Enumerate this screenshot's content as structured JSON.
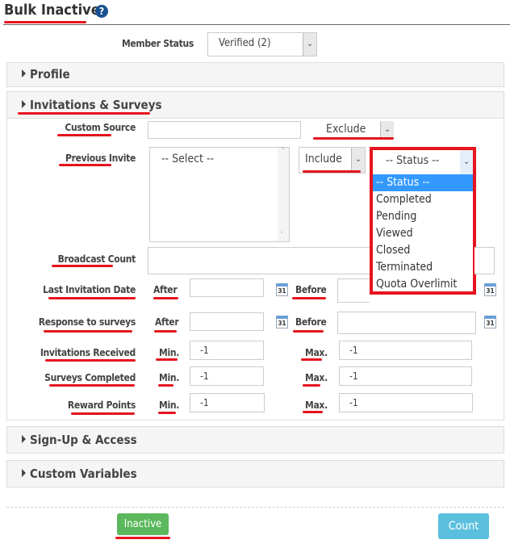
{
  "header": {
    "title": "Bulk Inactive",
    "help_icon": "question-circle-icon"
  },
  "member_status": {
    "label": "Member Status",
    "value": "Verified (2)"
  },
  "panels": {
    "profile": "Profile",
    "invitations": "Invitations & Surveys",
    "signup": "Sign-Up & Access",
    "custom_vars": "Custom Variables"
  },
  "form": {
    "custom_source": {
      "label": "Custom Source",
      "value": "",
      "mode": "Exclude"
    },
    "previous_invite": {
      "label": "Previous Invite",
      "placeholder": "-- Select --",
      "mode": "Include",
      "status": "-- Status --",
      "status_options": [
        "-- Status --",
        "Completed",
        "Pending",
        "Viewed",
        "Closed",
        "Terminated",
        "Quota Overlimit"
      ]
    },
    "broadcast_count": {
      "label": "Broadcast Count"
    },
    "last_invitation_date": {
      "label": "Last Invitation Date",
      "after": "After",
      "before": "Before"
    },
    "response_to_surveys": {
      "label": "Response to surveys",
      "after": "After",
      "before": "Before"
    },
    "invitations_received": {
      "label": "Invitations Received",
      "min_label": "Min.",
      "max_label": "Max.",
      "min": "-1",
      "max": "-1"
    },
    "surveys_completed": {
      "label": "Surveys Completed",
      "min_label": "Min.",
      "max_label": "Max.",
      "min": "-1",
      "max": "-1"
    },
    "reward_points": {
      "label": "Reward Points",
      "min_label": "Min.",
      "max_label": "Max.",
      "min": "-1",
      "max": "-1"
    },
    "calendar_day": "31"
  },
  "buttons": {
    "inactive": "Inactive",
    "count": "Count"
  },
  "colors": {
    "annotation": "#e5141e",
    "inactive": "#5cb85c",
    "count": "#5bc0de",
    "highlight": "#3399ff"
  }
}
